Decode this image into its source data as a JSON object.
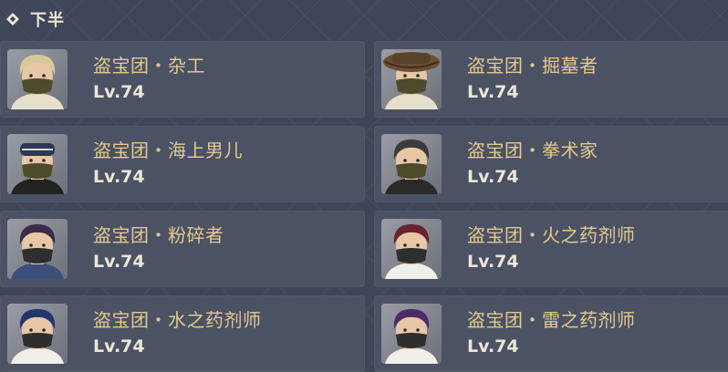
{
  "section": {
    "title": "下半"
  },
  "enemies": [
    {
      "name": "盗宝团・杂工",
      "level": "Lv.74",
      "icon": "treasure-hoarder-handyman-avatar",
      "skin": "#e8c7a6",
      "hair": "#d9c79a",
      "headwear": "none",
      "collar": "#e6dfcc",
      "mask": "#4e4a2c"
    },
    {
      "name": "盗宝团・掘墓者",
      "level": "Lv.74",
      "icon": "treasure-hoarder-gravedigger-avatar",
      "skin": "#e8c7a6",
      "hair": "#3a2c22",
      "headwear": "hat",
      "collar": "#e6dfcc",
      "mask": "#4e4a2c"
    },
    {
      "name": "盗宝团・海上男儿",
      "level": "Lv.74",
      "icon": "treasure-hoarder-seaman-avatar",
      "skin": "#e8c7a6",
      "hair": "#2c3a55",
      "headwear": "bandana",
      "collar": "#222222",
      "mask": "#4e4a2c"
    },
    {
      "name": "盗宝团・拳术家",
      "level": "Lv.74",
      "icon": "treasure-hoarder-pugilist-avatar",
      "skin": "#e8c7a6",
      "hair": "#3b3b3b",
      "headwear": "none",
      "collar": "#2a2a2a",
      "mask": "#4e4a2c"
    },
    {
      "name": "盗宝团・粉碎者",
      "level": "Lv.74",
      "icon": "treasure-hoarder-crusher-avatar",
      "skin": "#e8c7a6",
      "hair": "#3b2d4a",
      "headwear": "none",
      "collar": "#3a4f7a",
      "mask": "#2e2e2e"
    },
    {
      "name": "盗宝团・火之药剂师",
      "level": "Lv.74",
      "icon": "treasure-hoarder-pyro-potioneer-avatar",
      "skin": "#e8c7a6",
      "hair": "#6a2130",
      "headwear": "none",
      "collar": "#f0efea",
      "mask": "#2e2e2e"
    },
    {
      "name": "盗宝团・水之药剂师",
      "level": "Lv.74",
      "icon": "treasure-hoarder-hydro-potioneer-avatar",
      "skin": "#e8c7a6",
      "hair": "#23356e",
      "headwear": "none",
      "collar": "#f0efea",
      "mask": "#2e2e2e"
    },
    {
      "name": "盗宝团・雷之药剂师",
      "level": "Lv.74",
      "icon": "treasure-hoarder-electro-potioneer-avatar",
      "skin": "#e8c7a6",
      "hair": "#4e2a66",
      "headwear": "none",
      "collar": "#f0efea",
      "mask": "#2e2e2e"
    }
  ],
  "colors": {
    "background": "#3f4659",
    "card": "#4b5264",
    "name_text": "#e4c98e",
    "level_text": "#ece6d8",
    "header_text": "#ece5d6"
  }
}
